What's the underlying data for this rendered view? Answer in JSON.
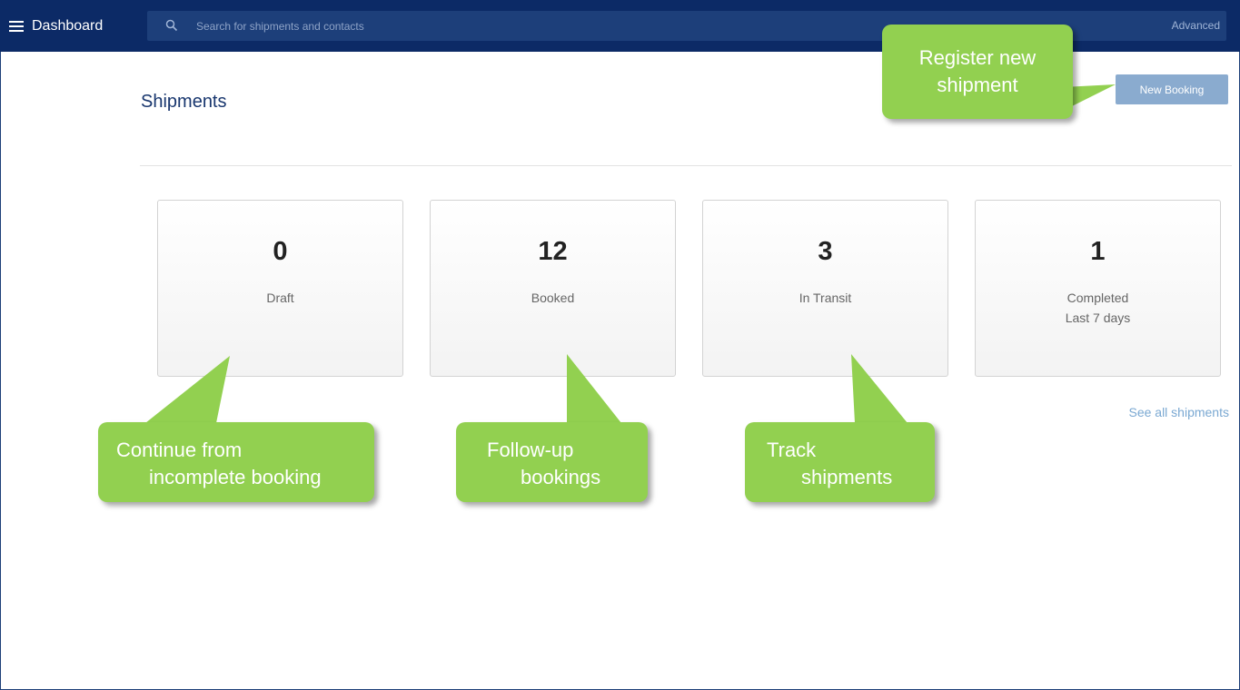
{
  "topbar": {
    "menu_title": "Dashboard",
    "search_placeholder": "Search for shipments and contacts",
    "advanced_label": "Advanced"
  },
  "page": {
    "title": "Shipments",
    "new_booking_label": "New Booking",
    "see_all_label": "See all shipments"
  },
  "cards": [
    {
      "count": "0",
      "label": "Draft",
      "sublabel": ""
    },
    {
      "count": "12",
      "label": "Booked",
      "sublabel": ""
    },
    {
      "count": "3",
      "label": "In Transit",
      "sublabel": ""
    },
    {
      "count": "1",
      "label": "Completed",
      "sublabel": "Last 7 days"
    }
  ],
  "callouts": {
    "register": {
      "line1": "Register new",
      "line2": "shipment"
    },
    "draft": {
      "line1": "Continue from",
      "line2": "incomplete booking"
    },
    "booked": {
      "line1": "Follow-up",
      "line2": "bookings"
    },
    "transit": {
      "line1": "Track",
      "line2": "shipments"
    }
  },
  "colors": {
    "topbar": "#0c2a66",
    "search": "#1d3f7a",
    "callout": "#92d050",
    "button": "#8aabcf",
    "link": "#7aa8d2"
  },
  "icons": {
    "menu": "hamburger-icon",
    "search": "search-icon"
  }
}
